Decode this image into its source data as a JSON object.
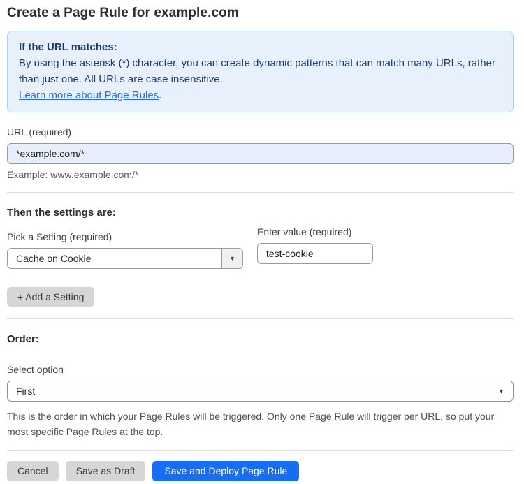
{
  "page": {
    "title": "Create a Page Rule for example.com"
  },
  "info_box": {
    "heading": "If the URL matches:",
    "body": "By using the asterisk (*) character, you can create dynamic patterns that can match many URLs, rather than just one. All URLs are case insensitive.",
    "link_label": "Learn more about Page Rules",
    "link_suffix": "."
  },
  "url_field": {
    "label": "URL (required)",
    "value": "*example.com/*",
    "example": "Example: www.example.com/*"
  },
  "settings_section": {
    "heading": "Then the settings are:",
    "setting_select": {
      "label": "Pick a Setting (required)",
      "value": "Cache on Cookie"
    },
    "value_field": {
      "label": "Enter value (required)",
      "value": "test-cookie"
    },
    "add_setting_label": "+ Add a Setting"
  },
  "order_section": {
    "heading": "Order:",
    "select_label": "Select option",
    "selected_option": "First",
    "help_text": "This is the order in which your Page Rules will be triggered. Only one Page Rule will trigger per URL, so put your most specific Page Rules at the top."
  },
  "actions": {
    "cancel_label": "Cancel",
    "save_draft_label": "Save as Draft",
    "save_deploy_label": "Save and Deploy Page Rule"
  },
  "icons": {
    "dropdown_arrow": "▼"
  },
  "colors": {
    "info_bg": "#e8f1fb",
    "info_border": "#a9cdee",
    "info_text": "#1d3c6e",
    "link": "#2c6cd6",
    "url_input_bg": "#e7effc",
    "primary_button": "#156ef5",
    "secondary_button": "#d6d6d6"
  }
}
